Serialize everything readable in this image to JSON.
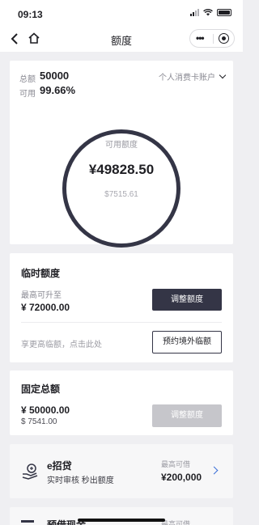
{
  "status_bar": {
    "time": "09:13"
  },
  "nav": {
    "title": "额度"
  },
  "quota": {
    "total_label": "总额",
    "total_value": "50000",
    "available_label": "可用",
    "available_value": "99.66%",
    "account_type": "个人消费卡账户",
    "ring_caption": "可用额度",
    "ring_amount": "¥49828.50",
    "ring_secondary": "$7515.61"
  },
  "temporary": {
    "title": "临时额度",
    "max_label": "最高可升至",
    "max_amount": "¥ 72000.00",
    "adjust_button": "调整额度",
    "hint": "享更高临额，点击此处",
    "book_button": "预约境外临额"
  },
  "fixed": {
    "title": "固定总额",
    "amount": "¥ 50000.00",
    "amount_usd": "$ 7541.00",
    "adjust_button": "调整额度"
  },
  "loan": {
    "title": "e招贷",
    "desc": "实时审核 秒出额度",
    "max_label": "最高可借",
    "max_value": "¥200,000"
  },
  "cash": {
    "title": "预借现金",
    "max_label": "最高可借"
  }
}
